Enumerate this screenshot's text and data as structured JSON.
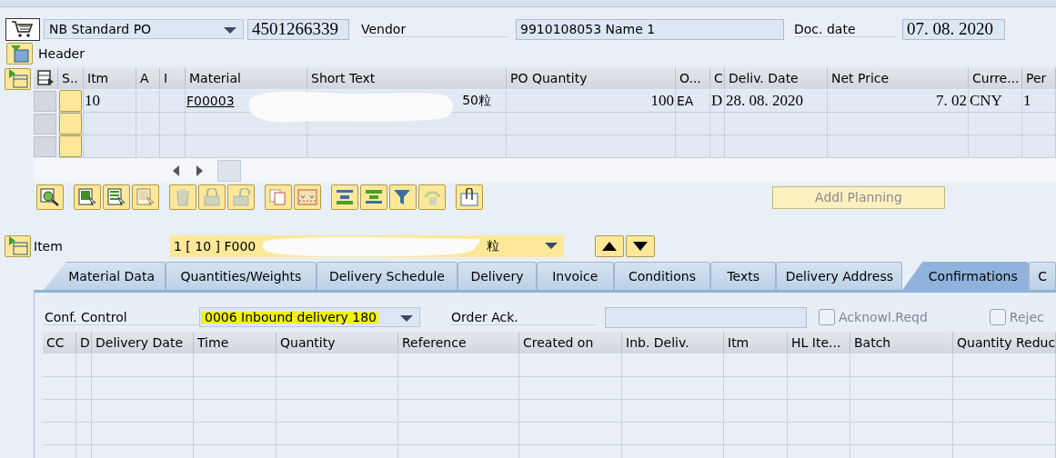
{
  "document": {
    "type": "NB Standard PO",
    "number": "4501266339",
    "vendor_label": "Vendor",
    "vendor": "9910108053 Name 1",
    "date_label": "Doc. date",
    "date": "07. 08. 2020"
  },
  "header": {
    "label": "Header"
  },
  "items_table": {
    "columns": [
      "S..",
      "Itm",
      "A",
      "I",
      "Material",
      "Short Text",
      "PO Quantity",
      "O...",
      "C",
      "Deliv. Date",
      "Net Price",
      "Curre...",
      "Per"
    ],
    "rows": [
      {
        "itm": "10",
        "material": "F00003",
        "short_text": "50粒",
        "po_quantity": "100",
        "unit": "EA",
        "c": "D",
        "deliv_date": "28. 08. 2020",
        "net_price": "7. 02",
        "currency": "CNY",
        "per": "1"
      }
    ]
  },
  "toolbar": [
    {
      "kind": "details",
      "disabled": false
    },
    {
      "kind": "select-all",
      "disabled": false
    },
    {
      "kind": "select-block",
      "disabled": false
    },
    {
      "kind": "deselect",
      "disabled": true
    },
    {
      "kind": "delete",
      "disabled": true
    },
    {
      "kind": "lock",
      "disabled": true
    },
    {
      "kind": "unlock",
      "disabled": true
    },
    {
      "kind": "copy",
      "disabled": false
    },
    {
      "kind": "split",
      "disabled": false
    },
    {
      "kind": "sort-up",
      "disabled": false
    },
    {
      "kind": "sort-down",
      "disabled": false
    },
    {
      "kind": "filter",
      "disabled": false
    },
    {
      "kind": "undo",
      "disabled": true
    },
    {
      "kind": "attach",
      "disabled": false
    }
  ],
  "addl_planning": {
    "label": "Addl Planning",
    "disabled": true
  },
  "item": {
    "label": "Item",
    "value_start": "1 [ 10 ] F000",
    "value_end": "粒"
  },
  "tabs": [
    {
      "label": "Material Data",
      "selected": false
    },
    {
      "label": "Quantities/Weights",
      "selected": false
    },
    {
      "label": "Delivery Schedule",
      "selected": false
    },
    {
      "label": "Delivery",
      "selected": false
    },
    {
      "label": "Invoice",
      "selected": false
    },
    {
      "label": "Conditions",
      "selected": false
    },
    {
      "label": "Texts",
      "selected": false
    },
    {
      "label": "Delivery Address",
      "selected": false
    },
    {
      "label": "Confirmations",
      "selected": true
    },
    {
      "label": "C",
      "selected": false
    }
  ],
  "confirmations": {
    "conf_control_label": "Conf. Control",
    "conf_control": "0006 Inbound delivery 180",
    "order_ack_label": "Order Ack.",
    "checkboxes": [
      {
        "label": "Acknowl.Reqd",
        "checked": false,
        "disabled": true
      },
      {
        "label": "Rejec",
        "checked": false,
        "disabled": true
      }
    ],
    "columns": [
      "CC",
      "D",
      "Delivery Date",
      "Time",
      "Quantity",
      "Reference",
      "Created on",
      "Inb. Deliv.",
      "Itm",
      "HL Ite...",
      "Batch",
      "Quantity Reduc"
    ]
  }
}
